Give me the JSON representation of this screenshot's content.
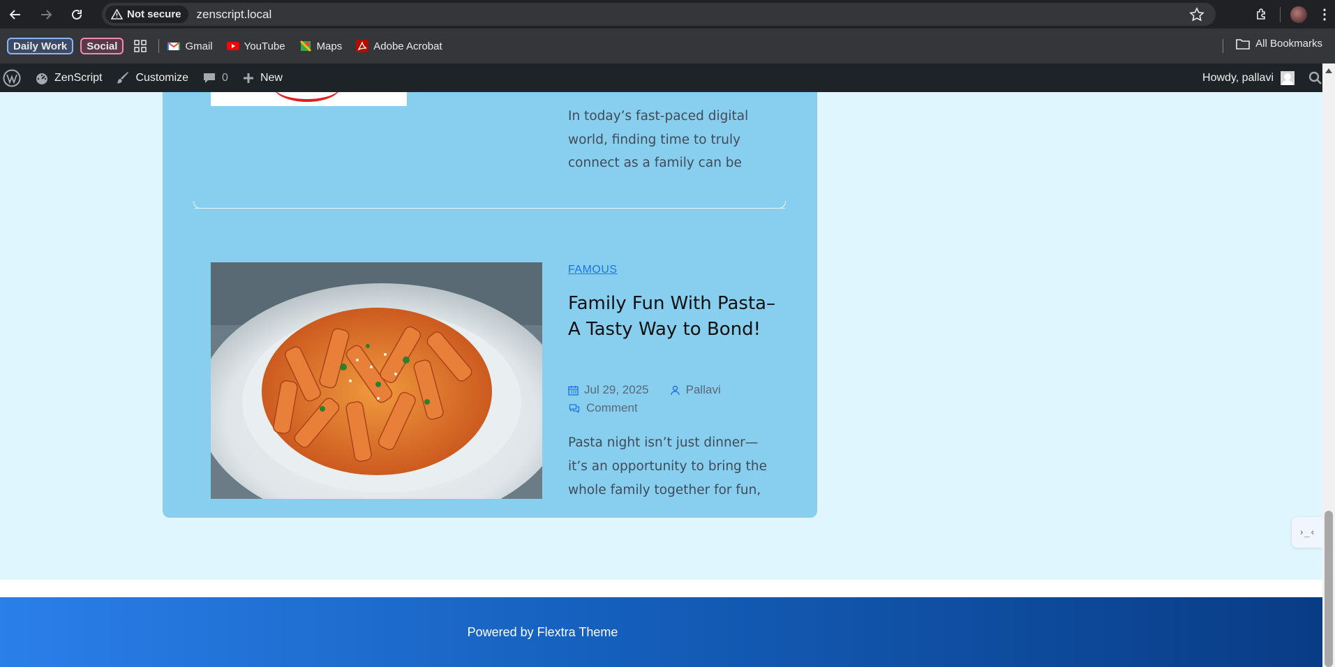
{
  "browser": {
    "security_label": "Not secure",
    "url": "zenscript.local",
    "icons": [
      "back-icon",
      "forward-icon",
      "reload-icon",
      "warning-icon",
      "star-icon",
      "extensions-icon",
      "profile-avatar",
      "menu-icon"
    ]
  },
  "bookmarks": {
    "groups": [
      {
        "label": "Daily Work",
        "color": "#8ab4f8"
      },
      {
        "label": "Social",
        "color": "#f28bb3"
      }
    ],
    "items": [
      {
        "label": "Gmail",
        "icon": "gmail-icon"
      },
      {
        "label": "YouTube",
        "icon": "youtube-icon"
      },
      {
        "label": "Maps",
        "icon": "maps-icon"
      },
      {
        "label": "Adobe Acrobat",
        "icon": "acrobat-icon"
      }
    ],
    "all_bookmarks": "All Bookmarks"
  },
  "wp_admin_bar": {
    "site_name": "ZenScript",
    "customize": "Customize",
    "comments_count": "0",
    "new_label": "New",
    "howdy": "Howdy, pallavi"
  },
  "posts": [
    {
      "excerpt": "In today’s fast-paced digital world, finding time to truly connect as a family can be"
    },
    {
      "category": "FAMOUS",
      "title": "Family Fun With Pasta– A Tasty Way to Bond!",
      "date": "Jul 29, 2025",
      "author": "Pallavi",
      "comment_label": "Comment",
      "excerpt": "Pasta night isn’t just dinner—it’s an opportunity to bring the whole family together for fun,"
    }
  ],
  "footer": {
    "text": "Powered by Flextra Theme"
  },
  "colors": {
    "page_bg": "#e0f6fe",
    "card_bg": "#88cfef",
    "accent": "#1e73e8",
    "footer_start": "#2b7fe9",
    "footer_end": "#093c86"
  }
}
